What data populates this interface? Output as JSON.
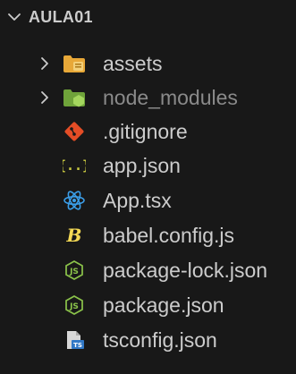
{
  "explorer": {
    "root": {
      "label": "AULA01",
      "expanded": true,
      "icon": "chevron-down-icon"
    },
    "items": [
      {
        "label": "assets",
        "type": "folder",
        "icon": "folder-icon",
        "expanded": false,
        "dimmed": false,
        "icon_color": "#e8a838"
      },
      {
        "label": "node_modules",
        "type": "folder",
        "icon": "node-folder-icon",
        "expanded": false,
        "dimmed": true,
        "icon_color": "#8bc34a"
      },
      {
        "label": ".gitignore",
        "type": "file",
        "icon": "git-icon",
        "dimmed": false,
        "icon_color": "#e44d26"
      },
      {
        "label": "app.json",
        "type": "file",
        "icon": "json-braces-icon",
        "dimmed": false,
        "icon_color": "#cbcb41"
      },
      {
        "label": "App.tsx",
        "type": "file",
        "icon": "react-icon",
        "dimmed": false,
        "icon_color": "#3b9ee8"
      },
      {
        "label": "babel.config.js",
        "type": "file",
        "icon": "babel-icon",
        "dimmed": false,
        "icon_color": "#f5da55"
      },
      {
        "label": "package-lock.json",
        "type": "file",
        "icon": "npm-js-icon",
        "dimmed": false,
        "icon_color": "#8bc34a"
      },
      {
        "label": "package.json",
        "type": "file",
        "icon": "npm-js-icon",
        "dimmed": false,
        "icon_color": "#8bc34a"
      },
      {
        "label": "tsconfig.json",
        "type": "file",
        "icon": "tsconfig-icon",
        "dimmed": false,
        "icon_color": "#3178c6"
      }
    ]
  }
}
